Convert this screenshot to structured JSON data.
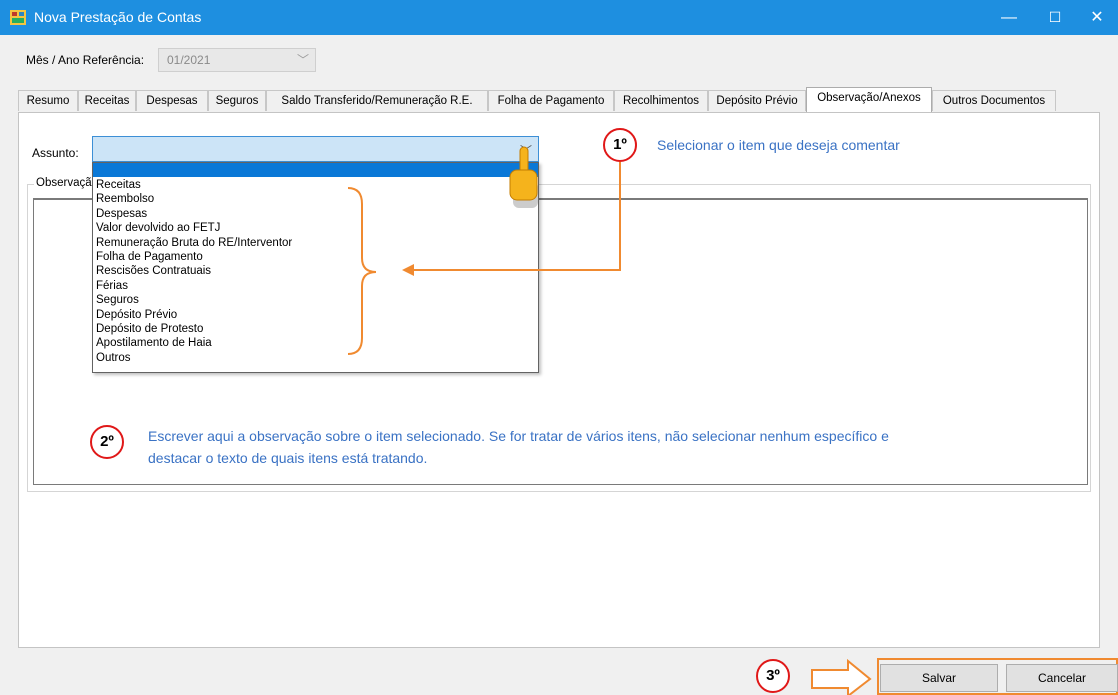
{
  "window": {
    "title": "Nova Prestação de Contas",
    "controls": {
      "minimize": "—",
      "maximize": "☐",
      "close": "✕"
    }
  },
  "reference": {
    "label": "Mês / Ano Referência:",
    "value": "01/2021"
  },
  "tabs": [
    "Resumo",
    "Receitas",
    "Despesas",
    "Seguros",
    "Saldo Transferido/Remuneração R.E.",
    "Folha de Pagamento",
    "Recolhimentos",
    "Depósito Prévio",
    "Observação/Anexos",
    "Outros Documentos"
  ],
  "active_tab": "Observação/Anexos",
  "assunto": {
    "label": "Assunto:",
    "value": "",
    "options": [
      "Receitas",
      "Reembolso",
      "Despesas",
      "Valor devolvido ao FETJ",
      "Remuneração Bruta do RE/Interventor",
      "Folha de Pagamento",
      "Rescisões Contratuais",
      "Férias",
      "Seguros",
      "Depósito Prévio",
      "Depósito de Protesto",
      "Apostilamento de Haia",
      "Outros"
    ]
  },
  "observacao": {
    "group_label": "Observaçã"
  },
  "annotations": {
    "step1": {
      "badge": "1º",
      "text": "Selecionar o item que deseja comentar"
    },
    "step2": {
      "badge": "2º",
      "line1": "Escrever aqui a observação sobre o item selecionado. Se for tratar de vários itens, não selecionar nenhum específico e",
      "line2": "destacar o texto de quais itens está tratando."
    },
    "step3": {
      "badge": "3º"
    }
  },
  "buttons": {
    "save": "Salvar",
    "cancel": "Cancelar"
  },
  "colors": {
    "titlebar": "#1e8fe0",
    "annotation_text": "#3a72c4",
    "annotation_circle": "#e01818",
    "annotation_arrow": "#f08a30",
    "selection": "#0a78d7"
  }
}
